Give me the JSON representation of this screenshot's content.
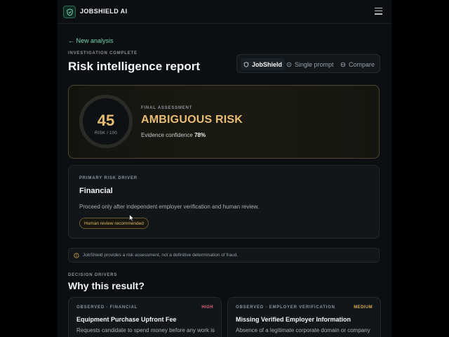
{
  "header": {
    "brand": "JOBSHIELD AI",
    "logo_icon": "shield-check-icon",
    "menu_icon": "hamburger-menu-icon"
  },
  "nav": {
    "back_label": "← New analysis"
  },
  "report": {
    "status_label": "INVESTIGATION COMPLETE",
    "title": "Risk intelligence report"
  },
  "mode_tabs": [
    {
      "label": "JobShield",
      "icon": "shield-icon",
      "active": true
    },
    {
      "label": "Single prompt",
      "icon": "circle-icon",
      "active": false
    },
    {
      "label": "Compare",
      "icon": "compare-icon",
      "active": false
    }
  ],
  "assessment": {
    "score": "45",
    "score_scale": "RISK / 100",
    "label": "FINAL ASSESSMENT",
    "verdict": "AMBIGUOUS RISK",
    "confidence_label": "Evidence confidence",
    "confidence_value": "78%"
  },
  "primary_driver": {
    "label": "PRIMARY RISK DRIVER",
    "title": "Financial",
    "description": "Proceed only after independent employer verification and human review.",
    "badge": "Human review recommended"
  },
  "notice": {
    "icon": "info-icon",
    "text": "JobShield provides a risk assessment, not a definitive determination of fraud."
  },
  "decision_drivers": {
    "label": "DECISION DRIVERS",
    "title": "Why this result?",
    "cards": [
      {
        "category": "OBSERVED · FINANCIAL",
        "severity": "HIGH",
        "title": "Equipment Purchase Upfront Fee",
        "description": "Requests candidate to spend money before any work is"
      },
      {
        "category": "OBSERVED · EMPLOYER VERIFICATION",
        "severity": "MEDIUM",
        "title": "Missing Verified Employer Information",
        "description": "Absence of a legitimate corporate domain or company"
      }
    ]
  },
  "colors": {
    "accent_green": "#79d3ad",
    "warning_amber": "#e7bd74",
    "severity_high": "#e0607a",
    "severity_medium": "#d8a848"
  }
}
